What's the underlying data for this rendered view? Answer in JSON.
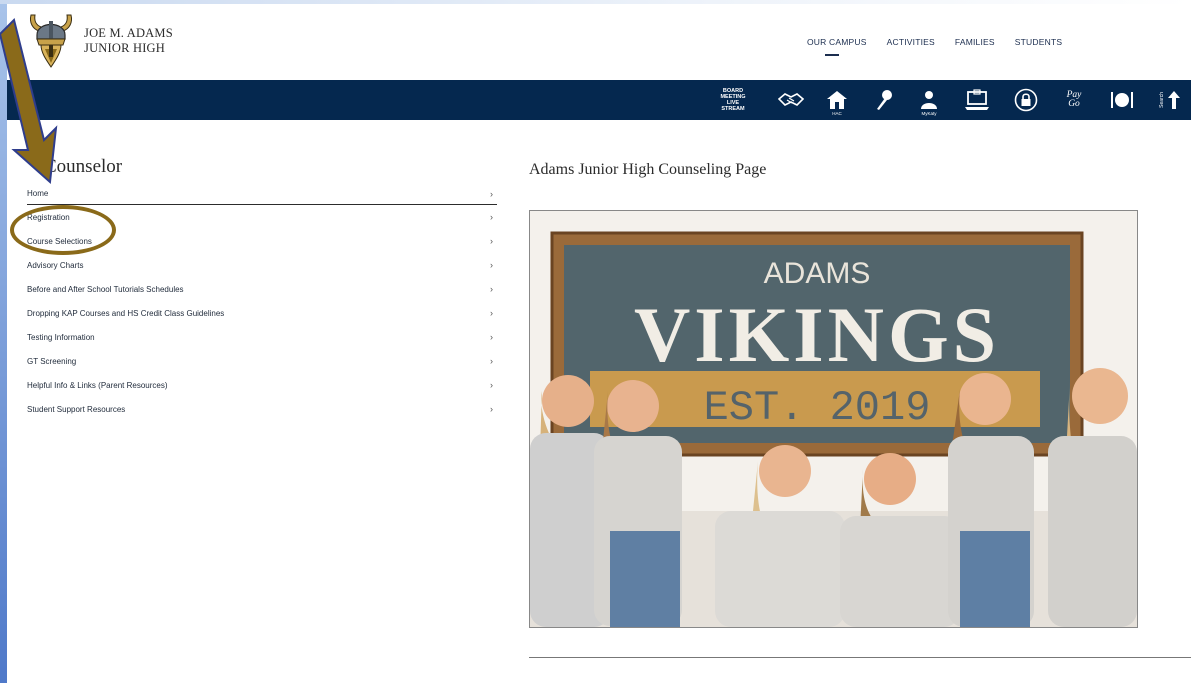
{
  "school": {
    "name_line1": "JOE M. ADAMS",
    "name_line2": "JUNIOR HIGH"
  },
  "top_nav": [
    {
      "label": "OUR CAMPUS",
      "active": true
    },
    {
      "label": "ACTIVITIES",
      "active": false
    },
    {
      "label": "FAMILIES",
      "active": false
    },
    {
      "label": "STUDENTS",
      "active": false
    }
  ],
  "quick_links": [
    {
      "icon": "board-meeting-livestream-icon",
      "line1": "BOARD",
      "line2": "MEETING",
      "line3": "LIVE",
      "line4": "STREAM"
    },
    {
      "icon": "handshake-icon"
    },
    {
      "icon": "hac-home-icon",
      "sub": "HAC"
    },
    {
      "icon": "pushpin-icon"
    },
    {
      "icon": "mykaty-person-icon",
      "sub": "MyKaty"
    },
    {
      "icon": "laptop-icon"
    },
    {
      "icon": "lock-icon"
    },
    {
      "icon": "pay-go-icon",
      "line1": "Pay",
      "line2": "Go"
    },
    {
      "icon": "dining-plate-icon"
    },
    {
      "icon": "search-sidebar-icon",
      "sub": "Search"
    }
  ],
  "sidebar": {
    "title": "Counselor",
    "items": [
      {
        "label": "Home"
      },
      {
        "label": "Registration"
      },
      {
        "label": "Course Selections"
      },
      {
        "label": "Advisory Charts"
      },
      {
        "label": "Before and After School Tutorials Schedules"
      },
      {
        "label": "Dropping KAP Courses and HS Credit Class Guidelines"
      },
      {
        "label": "Testing Information"
      },
      {
        "label": "GT Screening"
      },
      {
        "label": "Helpful Info & Links (Parent Resources)"
      },
      {
        "label": "Student Support Resources"
      }
    ],
    "chevron": "›"
  },
  "main": {
    "title": "Adams Junior High Counseling Page",
    "photo": {
      "sign_top": "ADAMS",
      "sign_main": "VIKINGS",
      "sign_est": "EST. 2019"
    }
  },
  "colors": {
    "brand_navy": "#05284f",
    "annotation_gold": "#8a6a1a"
  }
}
